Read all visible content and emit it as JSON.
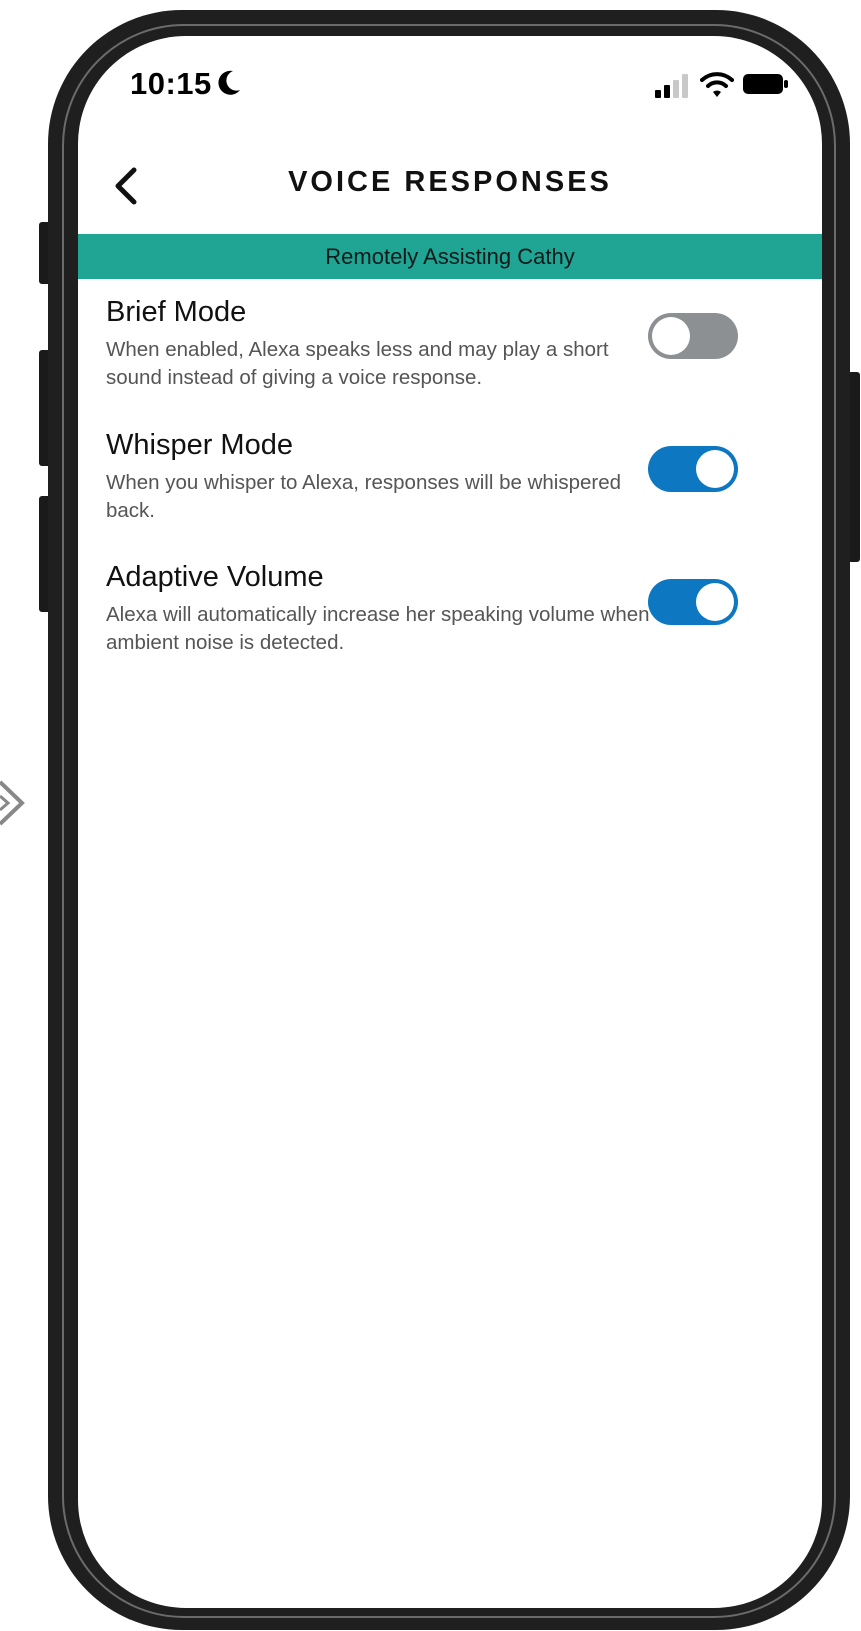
{
  "status_bar": {
    "time": "10:15",
    "icons": [
      "moon-icon",
      "signal-icon",
      "wifi-icon",
      "battery-icon"
    ]
  },
  "header": {
    "title": "VOICE RESPONSES",
    "back_icon": "chevron-left-icon"
  },
  "banner": {
    "text": "Remotely Assisting Cathy",
    "color": "#20a493"
  },
  "settings": [
    {
      "title": "Brief Mode",
      "description": "When enabled, Alexa speaks less and may play a short sound instead of giving a voice response.",
      "enabled": false
    },
    {
      "title": "Whisper Mode",
      "description": "When you whisper to Alexa, responses will be whispered back.",
      "enabled": true
    },
    {
      "title": "Adaptive Volume",
      "description": "Alexa will automatically increase her speaking volume when ambient noise is detected.",
      "enabled": true
    }
  ],
  "colors": {
    "toggle_on": "#0d77c2",
    "toggle_off": "#8c9093",
    "phone_frame": "#1f1f1f"
  }
}
